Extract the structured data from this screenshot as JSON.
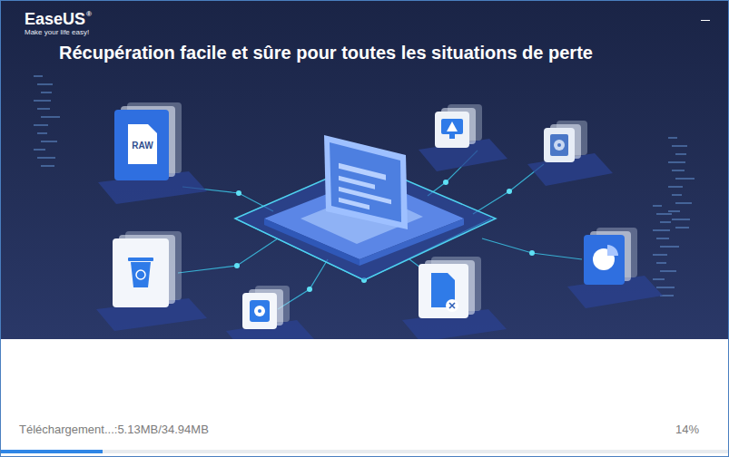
{
  "logo": {
    "name": "EaseUS",
    "mark": "®",
    "tagline": "Make your life easy!"
  },
  "title": "Récupération facile et sûre pour toutes les situations de perte",
  "illustration": {
    "file_label": "RAW"
  },
  "download": {
    "status": "Téléchargement...:5.13MB/34.94MB",
    "percent": "14%",
    "level": 0.14
  }
}
